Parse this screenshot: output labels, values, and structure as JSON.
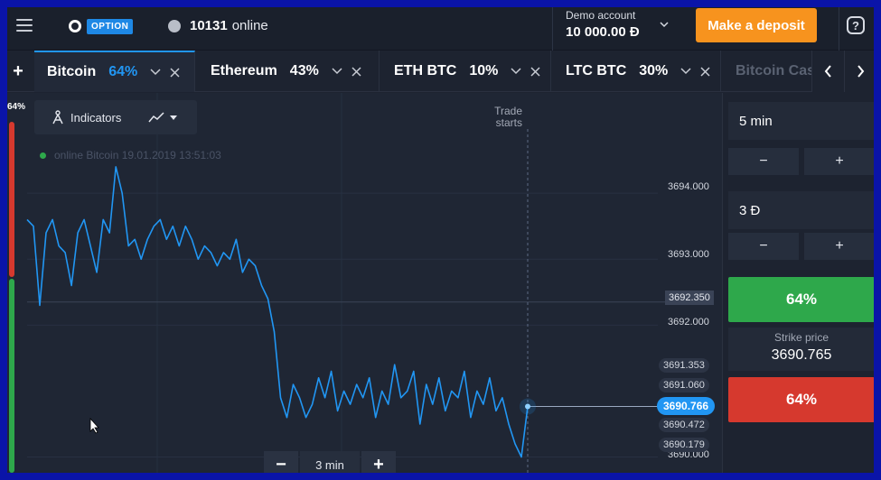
{
  "header": {
    "logo_text": "OPTION",
    "online_count": "10131",
    "online_label": "online",
    "account_label": "Demo account",
    "account_balance": "10 000.00 Đ",
    "deposit_label": "Make a deposit",
    "help_label": "?"
  },
  "tabs": {
    "add_label": "+",
    "items": [
      {
        "name": "Bitcoin",
        "pct": "64%"
      },
      {
        "name": "Ethereum",
        "pct": "43%"
      },
      {
        "name": "ETH BTC",
        "pct": "10%"
      },
      {
        "name": "LTC BTC",
        "pct": "30%"
      },
      {
        "name": "Bitcoin Cas",
        "pct": ""
      }
    ]
  },
  "sentiment": {
    "label": "64%"
  },
  "toolbar": {
    "indicators_label": "Indicators"
  },
  "asset_info": {
    "text": "online Bitcoin  19.01.2019 13:51:03"
  },
  "chart": {
    "trade_starts_line1": "Trade",
    "trade_starts_line2": "starts",
    "axis_ticks": [
      "3694.000",
      "3693.000",
      "3692.000",
      "3690.000"
    ],
    "level_tag": "3692.350",
    "price_tags": [
      "3691.353",
      "3691.060",
      "3690.472",
      "3690.179"
    ],
    "current_price": "3690.766",
    "zoom_value": "3 min",
    "zoom_minus": "−",
    "zoom_plus": "+"
  },
  "chart_data": {
    "type": "line",
    "series": [
      {
        "values": [
          3693.6,
          3693.5,
          3692.3,
          3693.4,
          3693.6,
          3693.2,
          3693.1,
          3692.6,
          3693.4,
          3693.6,
          3693.2,
          3692.8,
          3693.6,
          3693.4,
          3694.4,
          3694.0,
          3693.2,
          3693.3,
          3693.0,
          3693.3,
          3693.5,
          3693.6,
          3693.3,
          3693.5,
          3693.2,
          3693.5,
          3693.3,
          3693.0,
          3693.2,
          3693.1,
          3692.9,
          3693.1,
          3693.0,
          3693.3,
          3692.8,
          3693.0,
          3692.9,
          3692.6,
          3692.4,
          3691.9,
          3690.9,
          3690.6,
          3691.1,
          3690.9,
          3690.6,
          3690.8,
          3691.2,
          3690.9,
          3691.3,
          3690.7,
          3691.0,
          3690.8,
          3691.1,
          3690.9,
          3691.2,
          3690.6,
          3691.0,
          3690.8,
          3691.4,
          3690.9,
          3691.0,
          3691.3,
          3690.5,
          3691.1,
          3690.8,
          3691.2,
          3690.7,
          3691.0,
          3690.9,
          3691.3,
          3690.6,
          3691.0,
          3690.8,
          3691.2,
          3690.7,
          3690.9,
          3690.5,
          3690.2,
          3690.0,
          3690.766
        ]
      }
    ],
    "ylim": [
      3689.98,
      3694.7
    ],
    "level_line": 3692.35,
    "current": 3690.766
  },
  "panel": {
    "time_value": "5 min",
    "amount_value": "3 Đ",
    "minus": "−",
    "plus": "+",
    "up_label": "64%",
    "strike_label": "Strike price",
    "strike_value": "3690.765",
    "down_label": "64%"
  },
  "colors": {
    "accent": "#2196f3",
    "up": "#2ea84b",
    "down": "#d6392e",
    "deposit": "#f7931e"
  }
}
